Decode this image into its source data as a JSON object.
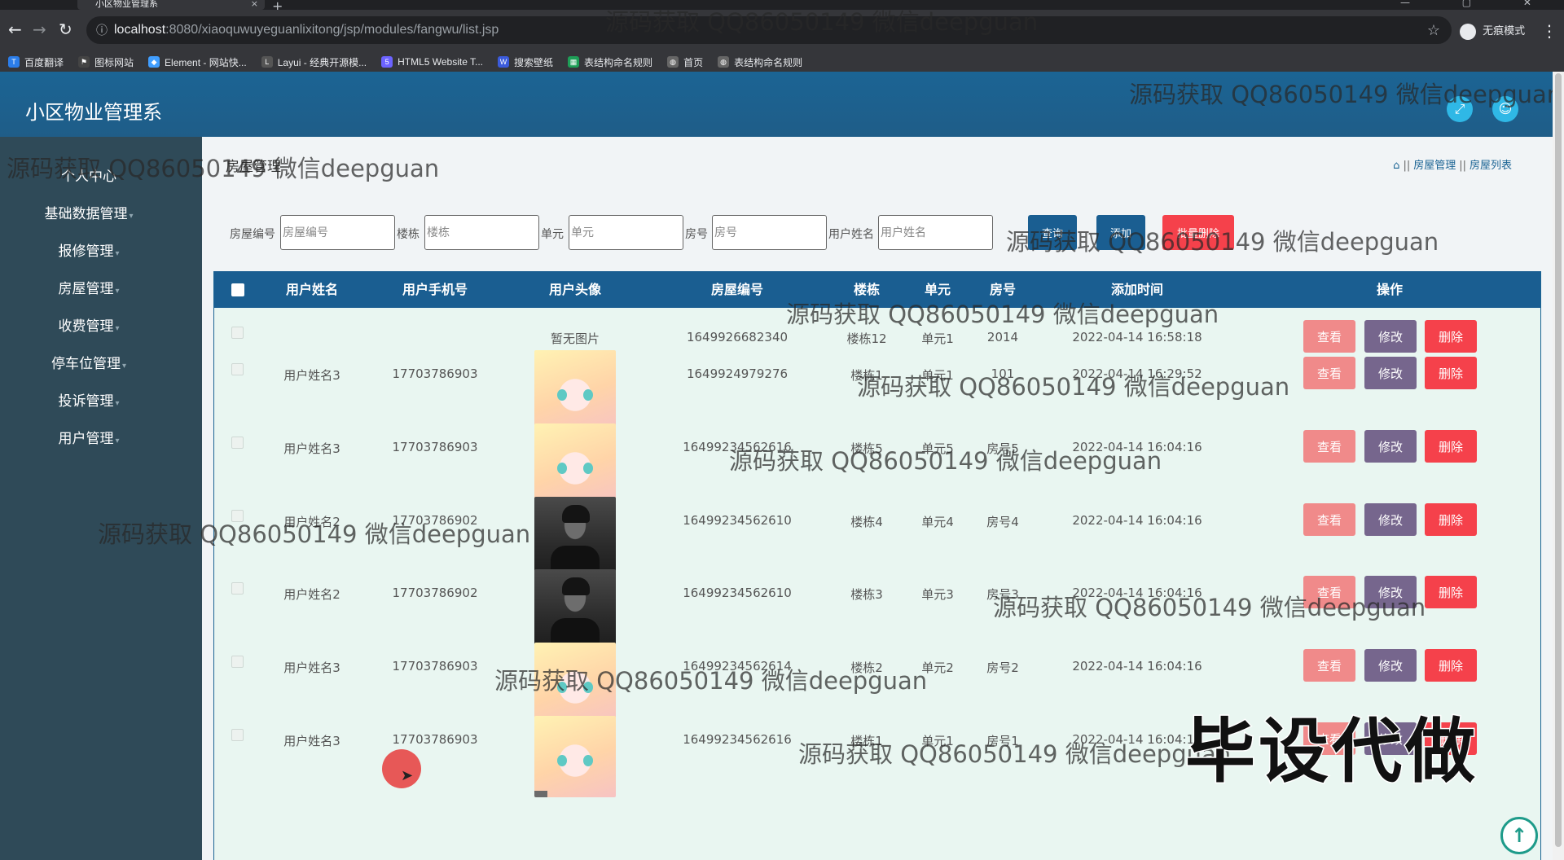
{
  "browser": {
    "tab_title": "小区物业管理系",
    "tab_close": "×",
    "tab_add": "+",
    "window_controls": "— ▢ ✕",
    "url_host": "localhost",
    "url_path": ":8080/xiaoquwuyeguanlixitong/jsp/modules/fangwu/list.jsp",
    "profile_label": "无痕模式",
    "bookmarks": [
      {
        "label": "百度翻译",
        "icon": "translate-icon",
        "color": "#2b7de9",
        "glyph": "T"
      },
      {
        "label": "图标网站",
        "icon": "flag-icon",
        "color": "#444444",
        "glyph": "⚑"
      },
      {
        "label": "Element - 网站快...",
        "icon": "element-icon",
        "color": "#409eff",
        "glyph": "◆"
      },
      {
        "label": "Layui - 经典开源模...",
        "icon": "layui-icon",
        "color": "#555555",
        "glyph": "L"
      },
      {
        "label": "HTML5 Website T...",
        "icon": "html5-icon",
        "color": "#6c63ff",
        "glyph": "5"
      },
      {
        "label": "搜索壁纸",
        "icon": "wallpaper-icon",
        "color": "#3b5bdb",
        "glyph": "W"
      },
      {
        "label": "表结构命名规则",
        "icon": "sheet-icon",
        "color": "#1e9e57",
        "glyph": "▦"
      },
      {
        "label": "首页",
        "icon": "globe-icon",
        "color": "#666666",
        "glyph": "◍"
      },
      {
        "label": "表结构命名规则",
        "icon": "globe-icon",
        "color": "#666666",
        "glyph": "◍"
      }
    ]
  },
  "app": {
    "title": "小区物业管理系",
    "colors": {
      "header": "#1b6494",
      "sidebar": "#2f4a58",
      "accent_cyan": "#2fb8e6"
    }
  },
  "sidebar": {
    "items": [
      {
        "label": "个人中心"
      },
      {
        "label": "基础数据管理"
      },
      {
        "label": "报修管理"
      },
      {
        "label": "房屋管理"
      },
      {
        "label": "收费管理"
      },
      {
        "label": "停车位管理"
      },
      {
        "label": "投诉管理"
      },
      {
        "label": "用户管理"
      }
    ]
  },
  "page": {
    "title": "房屋管理",
    "breadcrumb": [
      "房屋管理",
      "房屋列表"
    ]
  },
  "filters": [
    {
      "label": "房屋编号",
      "placeholder": "房屋编号"
    },
    {
      "label": "楼栋",
      "placeholder": "楼栋"
    },
    {
      "label": "单元",
      "placeholder": "单元"
    },
    {
      "label": "房号",
      "placeholder": "房号"
    },
    {
      "label": "用户姓名",
      "placeholder": "用户姓名"
    }
  ],
  "buttons": {
    "search": "查询",
    "add": "添加",
    "batch_delete": "批量删除"
  },
  "table": {
    "headers": [
      "用户姓名",
      "用户手机号",
      "用户头像",
      "房屋编号",
      "楼栋",
      "单元",
      "房号",
      "添加时间",
      "操作"
    ],
    "no_image_text": "暂无图片",
    "action_labels": {
      "view": "查看",
      "edit": "修改",
      "delete": "删除"
    },
    "rows": [
      {
        "name": "",
        "phone": "",
        "avatar": "none",
        "house_no": "1649926682340",
        "building": "楼栋12",
        "unit": "单元1",
        "room": "2014",
        "time": "2022-04-14 16:58:18"
      },
      {
        "name": "用户姓名3",
        "phone": "17703786903",
        "avatar": "anime",
        "house_no": "1649924979276",
        "building": "楼栋1",
        "unit": "单元1",
        "room": "101",
        "time": "2022-04-14 16:29:52"
      },
      {
        "name": "用户姓名3",
        "phone": "17703786903",
        "avatar": "anime",
        "house_no": "16499234562616",
        "building": "楼栋5",
        "unit": "单元5",
        "room": "房号5",
        "time": "2022-04-14 16:04:16"
      },
      {
        "name": "用户姓名2",
        "phone": "17703786902",
        "avatar": "photo",
        "house_no": "16499234562610",
        "building": "楼栋4",
        "unit": "单元4",
        "room": "房号4",
        "time": "2022-04-14 16:04:16"
      },
      {
        "name": "用户姓名2",
        "phone": "17703786902",
        "avatar": "photo",
        "house_no": "16499234562610",
        "building": "楼栋3",
        "unit": "单元3",
        "room": "房号3",
        "time": "2022-04-14 16:04:16"
      },
      {
        "name": "用户姓名3",
        "phone": "17703786903",
        "avatar": "anime",
        "house_no": "16499234562614",
        "building": "楼栋2",
        "unit": "单元2",
        "room": "房号2",
        "time": "2022-04-14 16:04:16"
      },
      {
        "name": "用户姓名3",
        "phone": "17703786903",
        "avatar": "anime",
        "house_no": "16499234562616",
        "building": "楼栋1",
        "unit": "单元1",
        "room": "房号1",
        "time": "2022-04-14 16:04:16"
      }
    ]
  },
  "overlays": {
    "watermark_text": "源码获取 QQ86050149 微信deepguan",
    "big_text": "毕设代做"
  }
}
